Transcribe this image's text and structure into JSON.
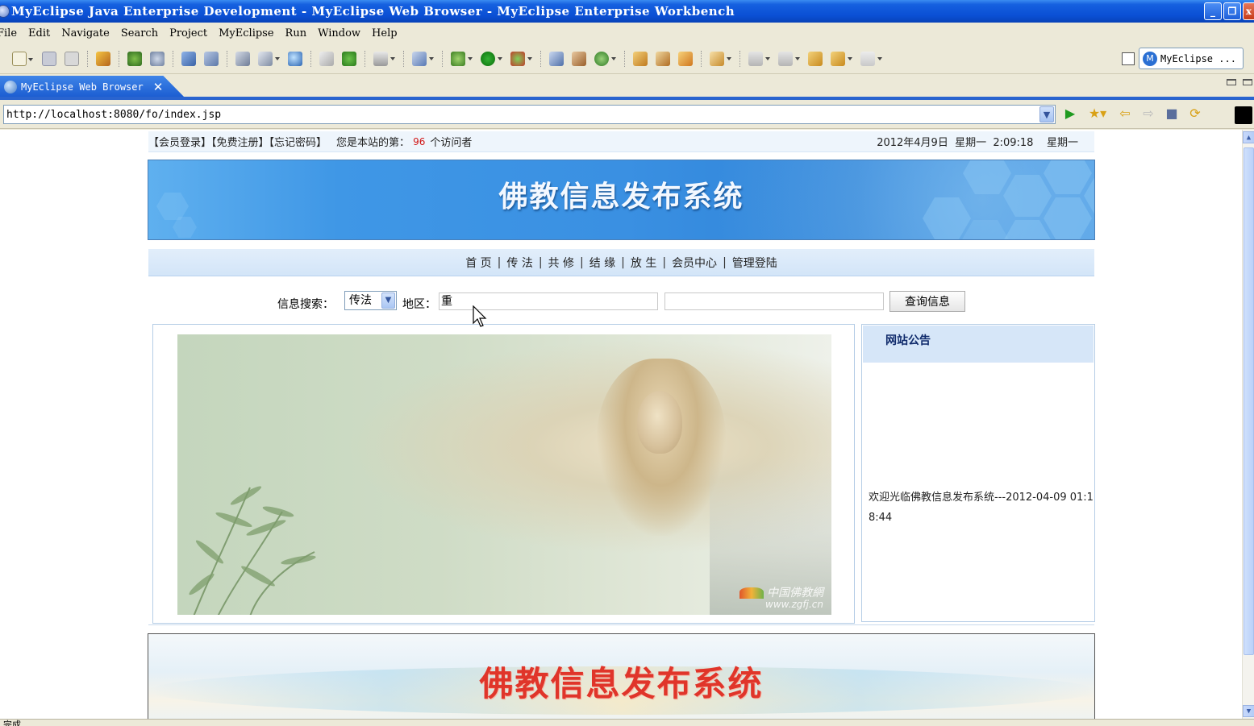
{
  "window": {
    "title": "MyEclipse Java Enterprise Development - MyEclipse Web Browser - MyEclipse Enterprise Workbench"
  },
  "menu": [
    "File",
    "Edit",
    "Navigate",
    "Search",
    "Project",
    "MyEclipse",
    "Run",
    "Window",
    "Help"
  ],
  "perspective": {
    "label": "MyEclipse ..."
  },
  "editor_tab": {
    "label": "MyEclipse Web Browser"
  },
  "address_bar": {
    "url": "http://localhost:8080/fo/index.jsp"
  },
  "page": {
    "top_links": [
      "【会员登录】",
      "【免费注册】",
      "【忘记密码】"
    ],
    "visitor_prefix": "您是本站的第：",
    "visitor_count": "96",
    "visitor_suffix": "个访问者",
    "datetime": "2012年4月9日  星期一  2:09:18    星期一",
    "banner_title": "佛教信息发布系统",
    "nav": [
      "首 页",
      "传 法",
      "共 修",
      "结 缘",
      "放 生",
      "会员中心",
      "管理登陆"
    ],
    "nav_separator": "|",
    "search": {
      "label": "信息搜索：",
      "category_selected": "传法",
      "area_label": "地区：",
      "area_value": "重",
      "keyword_value": "",
      "button_label": "查询信息"
    },
    "image_watermark": "中国佛教網",
    "image_watermark_url": "www.zgfj.cn",
    "notice": {
      "title": "网站公告",
      "text": "欢迎光临佛教信息发布系统---2012-04-09 01:18:44"
    },
    "footer_banner_title": "佛教信息发布系统"
  },
  "status": {
    "text": "完成"
  }
}
